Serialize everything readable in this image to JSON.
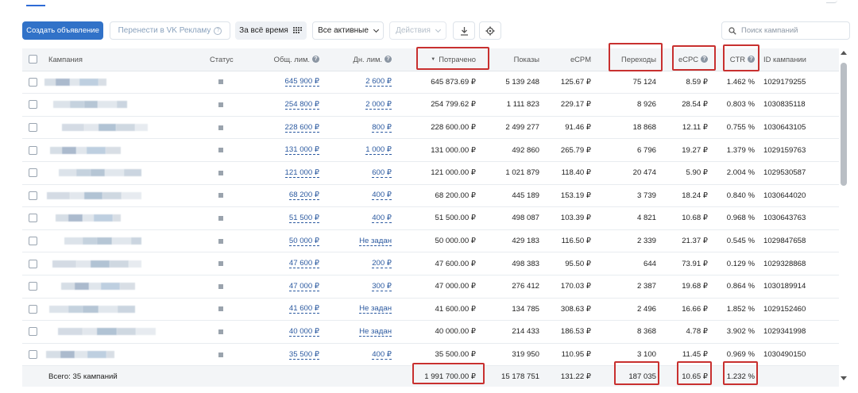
{
  "toolbar": {
    "create_label": "Создать объявление",
    "vk_label": "Перенести в VK Рекламу",
    "period_label": "За всё время",
    "status_filter": "Все активные",
    "actions_label": "Действия",
    "search_placeholder": "Поиск кампаний"
  },
  "table": {
    "columns": {
      "campaign": "Кампания",
      "status": "Статус",
      "total_limit": "Общ. лим.",
      "daily_limit": "Дн. лим.",
      "spent": "Потрачено",
      "impressions": "Показы",
      "ecpm": "eCPM",
      "clicks": "Переходы",
      "ecpc": "eCPC",
      "ctr": "CTR",
      "id": "ID кампании"
    },
    "rows": [
      {
        "total_limit": "645 900 ₽",
        "daily_limit": "2 600 ₽",
        "spent": "645 873.69 ₽",
        "impressions": "5 139 248",
        "ecpm": "125.67 ₽",
        "clicks": "75 124",
        "ecpc": "8.59 ₽",
        "ctr": "1.462 %",
        "id": "1029179255"
      },
      {
        "total_limit": "254 800 ₽",
        "daily_limit": "2 000 ₽",
        "spent": "254 799.62 ₽",
        "impressions": "1 111 823",
        "ecpm": "229.17 ₽",
        "clicks": "8 926",
        "ecpc": "28.54 ₽",
        "ctr": "0.803 %",
        "id": "1030835118"
      },
      {
        "total_limit": "228 600 ₽",
        "daily_limit": "800 ₽",
        "spent": "228 600.00 ₽",
        "impressions": "2 499 277",
        "ecpm": "91.46 ₽",
        "clicks": "18 868",
        "ecpc": "12.11 ₽",
        "ctr": "0.755 %",
        "id": "1030643105"
      },
      {
        "total_limit": "131 000 ₽",
        "daily_limit": "1 000 ₽",
        "spent": "131 000.00 ₽",
        "impressions": "492 860",
        "ecpm": "265.79 ₽",
        "clicks": "6 796",
        "ecpc": "19.27 ₽",
        "ctr": "1.379 %",
        "id": "1029159763"
      },
      {
        "total_limit": "121 000 ₽",
        "daily_limit": "600 ₽",
        "spent": "121 000.00 ₽",
        "impressions": "1 021 879",
        "ecpm": "118.40 ₽",
        "clicks": "20 474",
        "ecpc": "5.90 ₽",
        "ctr": "2.004 %",
        "id": "1029530587"
      },
      {
        "total_limit": "68 200 ₽",
        "daily_limit": "400 ₽",
        "spent": "68 200.00 ₽",
        "impressions": "445 189",
        "ecpm": "153.19 ₽",
        "clicks": "3 739",
        "ecpc": "18.24 ₽",
        "ctr": "0.840 %",
        "id": "1030644020"
      },
      {
        "total_limit": "51 500 ₽",
        "daily_limit": "400 ₽",
        "spent": "51 500.00 ₽",
        "impressions": "498 087",
        "ecpm": "103.39 ₽",
        "clicks": "4 821",
        "ecpc": "10.68 ₽",
        "ctr": "0.968 %",
        "id": "1030643763"
      },
      {
        "total_limit": "50 000 ₽",
        "daily_limit": "Не задан",
        "spent": "50 000.00 ₽",
        "impressions": "429 183",
        "ecpm": "116.50 ₽",
        "clicks": "2 339",
        "ecpc": "21.37 ₽",
        "ctr": "0.545 %",
        "id": "1029847658"
      },
      {
        "total_limit": "47 600 ₽",
        "daily_limit": "200 ₽",
        "spent": "47 600.00 ₽",
        "impressions": "498 383",
        "ecpm": "95.50 ₽",
        "clicks": "644",
        "ecpc": "73.91 ₽",
        "ctr": "0.129 %",
        "id": "1029328868"
      },
      {
        "total_limit": "47 000 ₽",
        "daily_limit": "300 ₽",
        "spent": "47 000.00 ₽",
        "impressions": "276 412",
        "ecpm": "170.03 ₽",
        "clicks": "2 387",
        "ecpc": "19.68 ₽",
        "ctr": "0.864 %",
        "id": "1030189914"
      },
      {
        "total_limit": "41 600 ₽",
        "daily_limit": "Не задан",
        "spent": "41 600.00 ₽",
        "impressions": "134 785",
        "ecpm": "308.63 ₽",
        "clicks": "2 496",
        "ecpc": "16.66 ₽",
        "ctr": "1.852 %",
        "id": "1029152460"
      },
      {
        "total_limit": "40 000 ₽",
        "daily_limit": "Не задан",
        "spent": "40 000.00 ₽",
        "impressions": "214 433",
        "ecpm": "186.53 ₽",
        "clicks": "8 368",
        "ecpc": "4.78 ₽",
        "ctr": "3.902 %",
        "id": "1029341998"
      },
      {
        "total_limit": "35 500 ₽",
        "daily_limit": "400 ₽",
        "spent": "35 500.00 ₽",
        "impressions": "319 950",
        "ecpm": "110.95 ₽",
        "clicks": "3 100",
        "ecpc": "11.45 ₽",
        "ctr": "0.969 %",
        "id": "1030490150"
      }
    ],
    "total": {
      "label": "Всего: 35 кампаний",
      "spent": "1 991 700.00 ₽",
      "impressions": "15 178 751",
      "ecpm": "131.22 ₽",
      "clicks": "187 035",
      "ecpc": "10.65 ₽",
      "ctr": "1.232 %"
    }
  },
  "colors": {
    "primary": "#3172c8",
    "link": "#2c5aa0",
    "highlight": "#c8302f"
  }
}
